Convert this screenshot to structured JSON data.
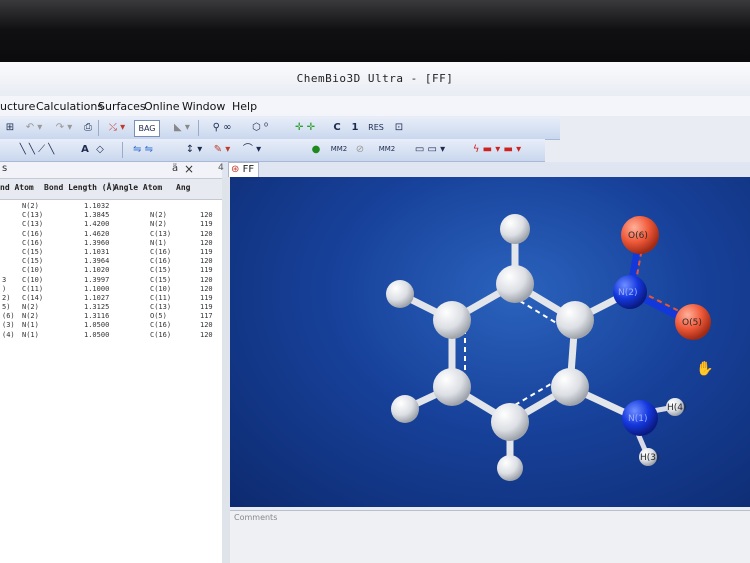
{
  "window": {
    "title": "ChemBio3D Ultra - [FF]"
  },
  "menu": [
    "ucture",
    "Calculations",
    "Surfaces",
    "Online",
    "Window",
    "Help"
  ],
  "toolbar": {
    "style_label": "BAG",
    "c_label": "C",
    "one_label": "1",
    "res_label": "RES",
    "mm2_label": "MM2",
    "mm2_b_label": "MM2",
    "text_tool": "A"
  },
  "panel": {
    "header_label": "s",
    "pin": "ä",
    "close": "×",
    "columns": [
      "nd Atom",
      "Bond Length (Å)",
      "Angle Atom",
      "Ang"
    ],
    "rows": [
      [
        "",
        "N(2)",
        "1.1032",
        "",
        ""
      ],
      [
        "",
        "C(13)",
        "1.3845",
        "N(2)",
        "120"
      ],
      [
        "",
        "C(13)",
        "1.4200",
        "N(2)",
        "119"
      ],
      [
        "",
        "C(16)",
        "1.4620",
        "C(13)",
        "120"
      ],
      [
        "",
        "C(16)",
        "1.3960",
        "N(1)",
        "120"
      ],
      [
        "",
        "C(15)",
        "1.1031",
        "C(16)",
        "119"
      ],
      [
        "",
        "C(15)",
        "1.3964",
        "C(16)",
        "120"
      ],
      [
        "",
        "C(10)",
        "1.1020",
        "C(15)",
        "119"
      ],
      [
        "3",
        "C(10)",
        "1.3997",
        "C(15)",
        "120"
      ],
      [
        ")",
        "C(11)",
        "1.1000",
        "C(10)",
        "120"
      ],
      [
        "2)",
        "C(14)",
        "1.1027",
        "C(11)",
        "119"
      ],
      [
        "5)",
        "N(2)",
        "1.3125",
        "C(13)",
        "119"
      ],
      [
        "(6)",
        "N(2)",
        "1.3116",
        "O(5)",
        "117"
      ],
      [
        "(3)",
        "N(1)",
        "1.0500",
        "C(16)",
        "120"
      ],
      [
        "(4)",
        "N(1)",
        "1.0500",
        "C(16)",
        "120"
      ]
    ]
  },
  "tab": {
    "label": "FF",
    "number": "4"
  },
  "viewer": {
    "labels": {
      "o6": "O(6)",
      "n2": "N(2)",
      "o5": "O(5)",
      "n1": "N(1)",
      "h4": "H(4)",
      "h3": "H(3)"
    }
  },
  "comments": {
    "label": "Comments"
  },
  "colors": {
    "background": "#17419a",
    "oxygen": "#e8543a",
    "nitrogen": "#1338d9",
    "carbon": "#e4e6ea"
  }
}
